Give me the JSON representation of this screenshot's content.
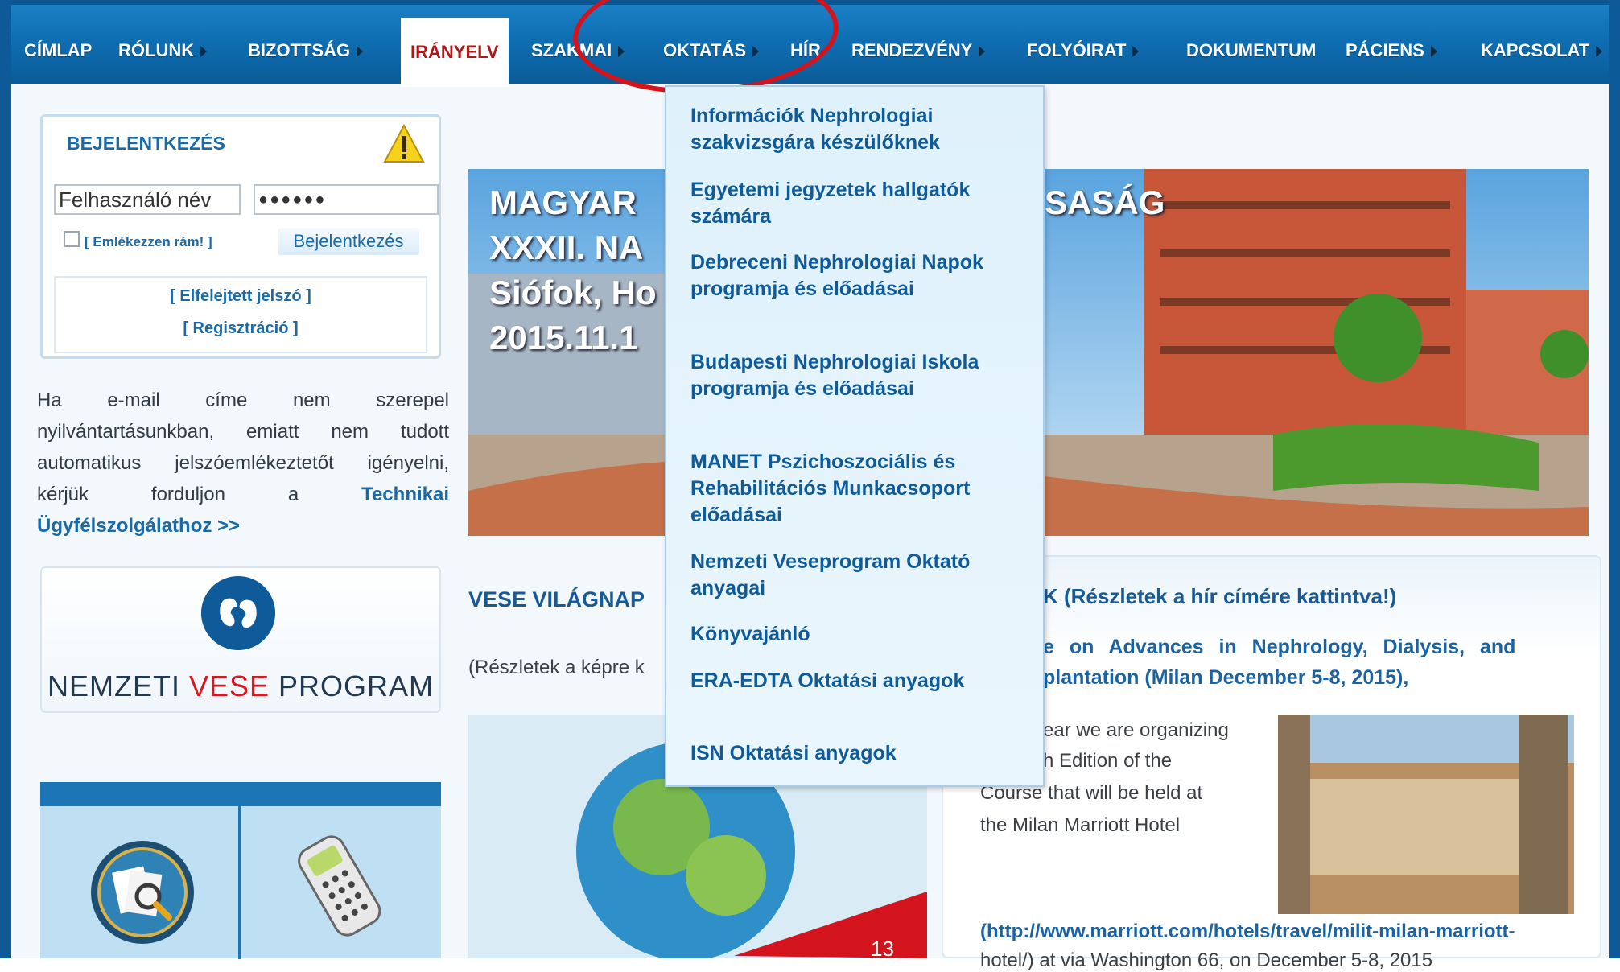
{
  "nav": {
    "items": [
      {
        "label": "CÍMLAP",
        "arrow": false
      },
      {
        "label": "RÓLUNK",
        "arrow": true
      },
      {
        "label": "BIZOTTSÁG",
        "arrow": true
      },
      {
        "label": "IRÁNYELV",
        "arrow": false,
        "active": true
      },
      {
        "label": "SZAKMAI",
        "arrow": true
      },
      {
        "label": "OKTATÁS",
        "arrow": true
      },
      {
        "label": "HÍR",
        "arrow": false
      },
      {
        "label": "RENDEZVÉNY",
        "arrow": true
      },
      {
        "label": "FOLYÓIRAT",
        "arrow": true
      },
      {
        "label": "DOKUMENTUM",
        "arrow": false
      },
      {
        "label": "PÁCIENS",
        "arrow": true
      },
      {
        "label": "KAPCSOLAT",
        "arrow": true
      }
    ]
  },
  "dropdown": {
    "items": [
      "Információk Nephrologiai szakvizsgára készülőknek",
      "Egyetemi jegyzetek hallgatók számára",
      "Debreceni Nephrologiai Napok programja és előadásai",
      "Budapesti Nephrologiai Iskola programja és előadásai",
      "MANET Pszichoszociális és Rehabilitációs Munkacsoport előadásai",
      "Nemzeti Veseprogram Oktató anyagai",
      "Könyvajánló",
      "ERA-EDTA Oktatási anyagok",
      "ISN Oktatási anyagok"
    ]
  },
  "login": {
    "title": "BEJELENTKEZÉS",
    "username_value": "Felhasználó név",
    "password_value": "●●●●●●",
    "remember_label": "[ Emlékezzen rám! ]",
    "login_button": "Bejelentkezés",
    "forgot_link": "[ Elfelejtett jelszó ]",
    "register_link": "[ Regisztráció ]"
  },
  "help": {
    "text": "Ha e-mail címe nem szerepel nyilvántartásunkban, emiatt nem tudott automatikus jelszóemlékeztetőt igényelni, kérjük forduljon a",
    "link": "Technikai Ügyfélszolgálathoz >>"
  },
  "nvp": {
    "part1": "NEMZETI ",
    "part2": "VESE",
    "part3": " PROGRAM"
  },
  "banner": {
    "line1": "MAGYAR ",
    "line1b": "SASÁG",
    "line2": "XXXII. NA",
    "line3": "Siófok, Ho",
    "line4": "2015.11.1"
  },
  "content": {
    "vese_title": "VESE VILÁGNAP",
    "vese_sub": "(Részletek a képre k",
    "news_title": "K (Részletek a hír címére kattintva!)",
    "news_line1": "e on Advances in Nephrology, Dialysis, and",
    "news_line2": "plantation (Milan December 5-8, 2015),",
    "news_p1": "ear we are organizing",
    "news_p2": "h Edition of the",
    "news_p3": "Course that will be held at",
    "news_p4": "the Milan Marriott Hotel",
    "news_link": "(http://www.marriott.com/hotels/travel/milit-milan-marriott-",
    "news_link2": "hotel/) at via Washington 66, on December 5-8, 2015",
    "card_number": "13"
  },
  "colors": {
    "nav": "#0f6eb2",
    "accent": "#1a63a2",
    "red": "#d4141c"
  }
}
